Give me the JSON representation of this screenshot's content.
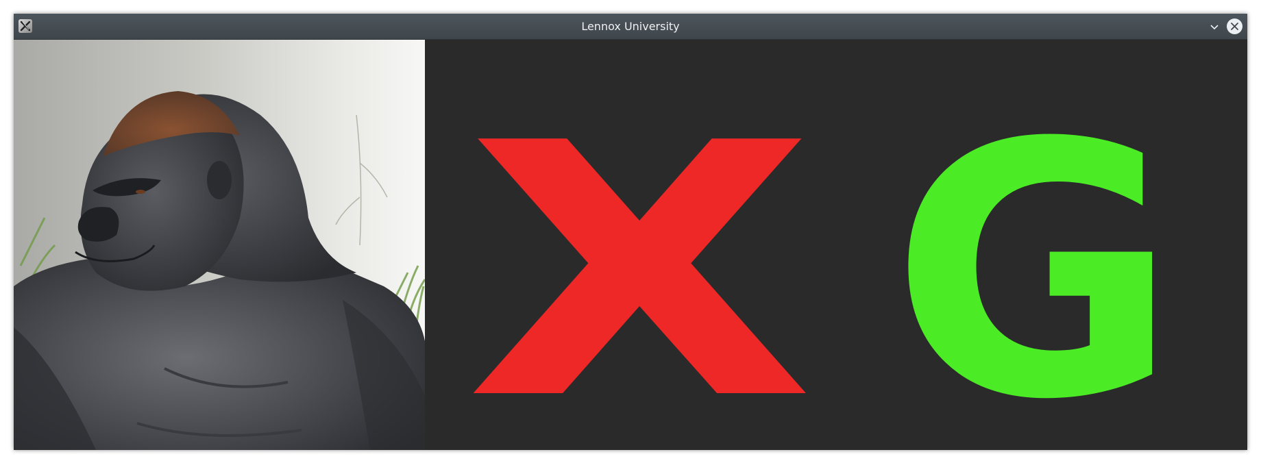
{
  "window": {
    "title": "Lennox University",
    "app_icon": "x11-app-icon",
    "controls": {
      "minimize_icon": "chevron-down-icon",
      "close_icon": "close-icon"
    }
  },
  "content": {
    "photo": {
      "subject_icon": "gorilla-photo"
    },
    "letters": [
      {
        "text": "X",
        "color": "#ee2727"
      },
      {
        "text": "G",
        "color": "#4bec26"
      }
    ],
    "background_color": "#2a2a2a"
  }
}
